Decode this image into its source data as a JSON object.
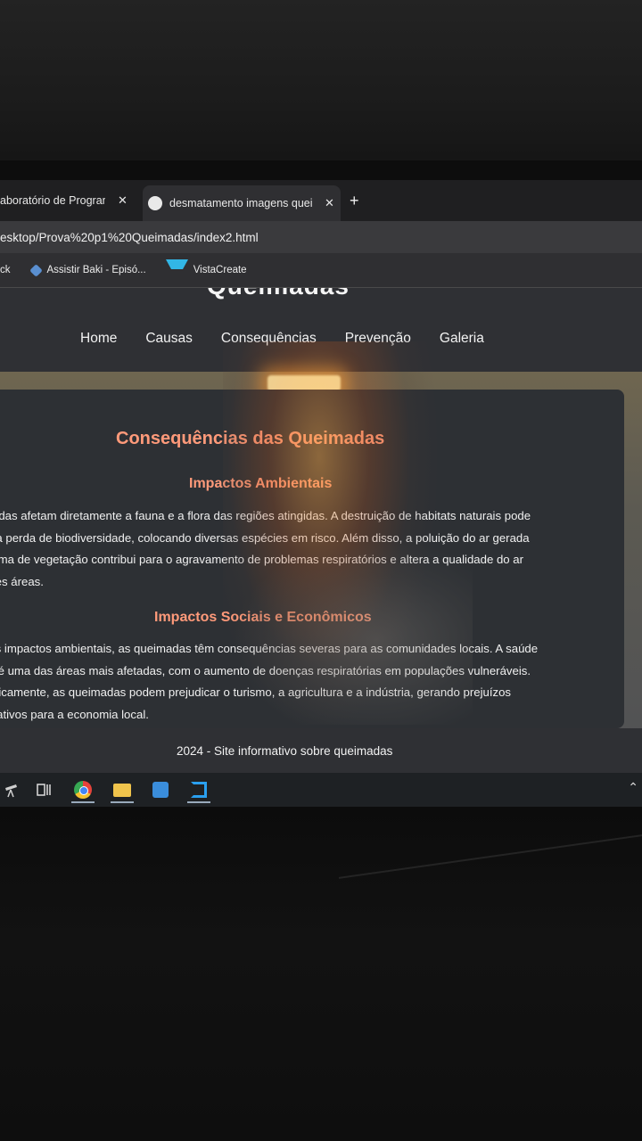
{
  "browser": {
    "tabs": [
      {
        "label": "aboratório de Programa"
      },
      {
        "label": "desmatamento imagens queim"
      }
    ],
    "address_bar": {
      "url": "esktop/Prova%20p1%20Queimadas/index2.html"
    },
    "bookmarks": [
      {
        "label": "ck"
      },
      {
        "label": "Assistir Baki - Episó..."
      },
      {
        "label": "VistaCreate"
      }
    ]
  },
  "site": {
    "title": "Queimadas",
    "nav": [
      "Home",
      "Causas",
      "Consequências",
      "Prevenção",
      "Galeria"
    ],
    "heading": "Consequências das Queimadas",
    "sections": [
      {
        "subheading": "Impactos Ambientais",
        "lines": [
          "madas afetam diretamente a fauna e a flora das regiões atingidas. A destruição de habitats naturais pode",
          "r na perda de biodiversidade, colocando diversas espécies em risco. Além disso, a poluição do ar gerada",
          "ueima de vegetação contribui para o agravamento de problemas respiratórios e altera a qualidade do ar",
          "ndes áreas."
        ]
      },
      {
        "subheading": "Impactos Sociais e Econômicos",
        "lines": [
          "dos impactos ambientais, as queimadas têm consequências severas para as comunidades locais. A saúde",
          "ca é uma das áreas mais afetadas, com o aumento de doenças respiratórias em populações vulneráveis.",
          "omicamente, as queimadas podem prejudicar o turismo, a agricultura e a indústria, gerando prejuízos",
          "ificativos para a economia local."
        ]
      }
    ],
    "footer": "2024 - Site informativo sobre queimadas"
  },
  "taskbar": {
    "icons": [
      "telescope-icon",
      "task-view-icon",
      "chrome-icon",
      "file-explorer-icon",
      "store-icon",
      "vscode-icon",
      "chevron-up-icon"
    ]
  }
}
